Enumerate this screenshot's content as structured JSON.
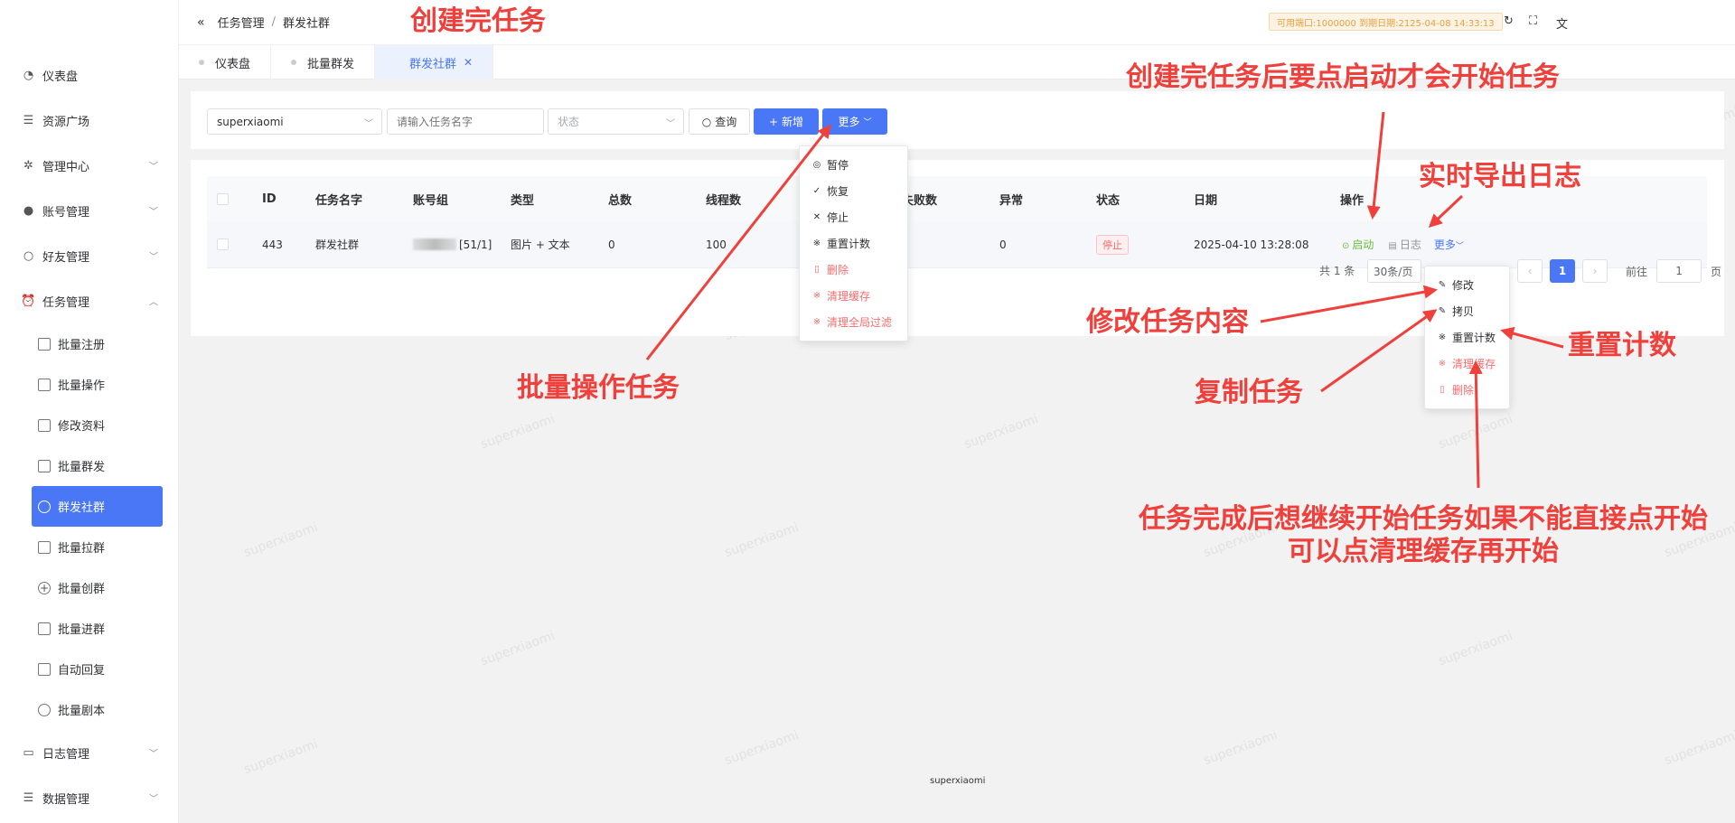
{
  "header": {
    "breadcrumb": [
      "任务管理",
      "群发社群"
    ],
    "license": "可用端口:1000000 到期日期:2125-04-08 14:33:13"
  },
  "sidebar": {
    "items": [
      {
        "label": "仪表盘",
        "icon": "dashboard-icon"
      },
      {
        "label": "资源广场",
        "icon": "database-icon"
      },
      {
        "label": "管理中心",
        "icon": "gear-icon",
        "expandable": true
      },
      {
        "label": "账号管理",
        "icon": "user-icon",
        "expandable": true
      },
      {
        "label": "好友管理",
        "icon": "user-outline-icon",
        "expandable": true
      },
      {
        "label": "任务管理",
        "icon": "alarm-clock-icon",
        "expandable": true,
        "expanded": true
      }
    ],
    "task_submenu": [
      {
        "label": "批量注册",
        "icon": "phone-icon"
      },
      {
        "label": "批量操作",
        "icon": "clipboard-icon"
      },
      {
        "label": "修改资料",
        "icon": "document-icon"
      },
      {
        "label": "批量群发",
        "icon": "mail-icon"
      },
      {
        "label": "群发社群",
        "icon": "chat-icon",
        "active": true
      },
      {
        "label": "批量拉群",
        "icon": "message-icon"
      },
      {
        "label": "批量创群",
        "icon": "plus-circle-icon"
      },
      {
        "label": "批量进群",
        "icon": "hand-icon"
      },
      {
        "label": "自动回复",
        "icon": "message-icon"
      },
      {
        "label": "批量剧本",
        "icon": "chat-icon"
      }
    ],
    "bottom_items": [
      {
        "label": "日志管理",
        "icon": "message-icon",
        "expandable": true
      },
      {
        "label": "数据管理",
        "icon": "database-icon",
        "expandable": true
      }
    ]
  },
  "tabs": [
    {
      "label": "仪表盘"
    },
    {
      "label": "批量群发"
    },
    {
      "label": "群发社群",
      "active": true
    }
  ],
  "search": {
    "account_select": "superxiaomi",
    "task_name_placeholder": "请输入任务名字",
    "status_placeholder": "状态",
    "query_button": "查询",
    "add_button": "新增",
    "more_button": "更多"
  },
  "table": {
    "headers": [
      "ID",
      "任务名字",
      "账号组",
      "类型",
      "总数",
      "线程数",
      "失败数",
      "异常",
      "状态",
      "日期",
      "操作"
    ],
    "rows": [
      {
        "id": "443",
        "name": "群发社群",
        "account_group_suffix": "[51/1]",
        "type": "图片 + 文本",
        "total": "0",
        "threads": "100",
        "abnormal": "0",
        "status": "停止",
        "date": "2025-04-10 13:28:08",
        "ops": {
          "start": "启动",
          "log": "日志",
          "more": "更多"
        }
      }
    ]
  },
  "pagination": {
    "total": "共 1 条",
    "page_size": "30条/页",
    "current_page": "1",
    "goto_label": "前往",
    "goto_value": "1",
    "page_suffix": "页"
  },
  "batch_dropdown": [
    {
      "label": "暂停",
      "icon": "pause-icon",
      "danger": false
    },
    {
      "label": "恢复",
      "icon": "check-icon",
      "danger": false
    },
    {
      "label": "停止",
      "icon": "close-icon",
      "danger": false
    },
    {
      "label": "重置计数",
      "icon": "loading-icon",
      "danger": false
    },
    {
      "label": "删除",
      "icon": "trash-icon",
      "danger": true
    },
    {
      "label": "清理缓存",
      "icon": "loading-icon",
      "danger": true
    },
    {
      "label": "清理全局过滤",
      "icon": "loading-icon",
      "danger": true
    }
  ],
  "row_dropdown": [
    {
      "label": "修改",
      "icon": "edit-icon",
      "danger": false
    },
    {
      "label": "拷贝",
      "icon": "edit-icon",
      "danger": false
    },
    {
      "label": "重置计数",
      "icon": "loading-icon",
      "danger": false
    },
    {
      "label": "清理缓存",
      "icon": "loading-icon",
      "danger": true
    },
    {
      "label": "删除",
      "icon": "trash-icon",
      "danger": true
    }
  ],
  "annotations": {
    "created": "创建完任务",
    "start_hint": "创建完任务后要点启动才会开始任务",
    "log_hint": "实时导出日志",
    "modify": "修改任务内容",
    "reset": "重置计数",
    "copy": "复制任务",
    "batch": "批量操作任务",
    "cache_line1": "任务完成后想继续开始任务如果不能直接点开始",
    "cache_line2": "可以点清理缓存再开始"
  },
  "watermark": "superxiaomi",
  "colors": {
    "primary": "#4a77f5",
    "annotation": "#f0403c",
    "success": "#67c23a",
    "danger": "#f56c6c"
  }
}
